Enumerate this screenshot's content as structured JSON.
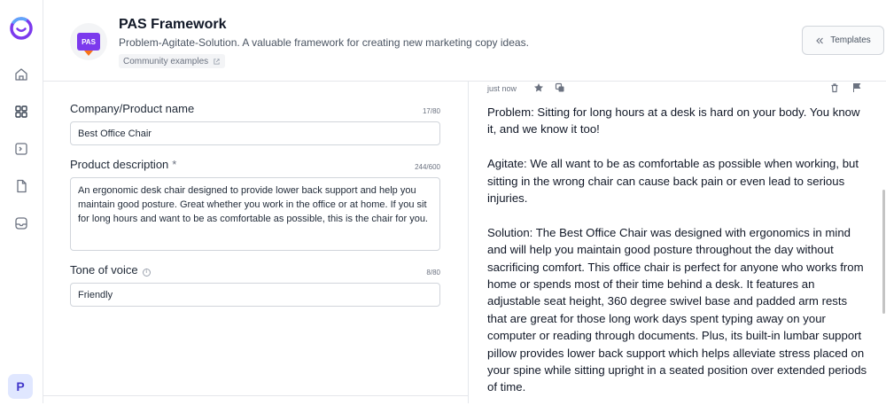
{
  "header": {
    "icon_label": "PAS",
    "title": "PAS Framework",
    "subtitle": "Problem-Agitate-Solution. A valuable framework for creating new marketing copy ideas.",
    "community_link": "Community examples",
    "templates_button": "Templates"
  },
  "sidebar": {
    "items": [
      {
        "icon": "home-icon"
      },
      {
        "icon": "grid-icon"
      },
      {
        "icon": "terminal-icon"
      },
      {
        "icon": "document-icon"
      },
      {
        "icon": "inbox-icon"
      }
    ],
    "avatar_initial": "P"
  },
  "form": {
    "company": {
      "label": "Company/Product name",
      "count": "17/80",
      "value": "Best Office Chair"
    },
    "description": {
      "label": "Product description",
      "required_marker": "*",
      "count": "244/600",
      "value": "An ergonomic desk chair designed to provide lower back support and help you maintain good posture. Great whether you work in the office or at home. If you sit for long hours and want to be as comfortable as possible, this is the chair for you."
    },
    "tone": {
      "label": "Tone of voice",
      "count": "8/80",
      "value": "Friendly"
    }
  },
  "output": {
    "timestamp": "just now",
    "paragraphs": [
      "Problem: Sitting for long hours at a desk is hard on your body. You know it, and we know it too!",
      "Agitate: We all want to be as comfortable as possible when working, but sitting in the wrong chair can cause back pain or even lead to serious injuries.",
      "Solution: The Best Office Chair was designed with ergonomics in mind and will help you maintain good posture throughout the day without sacrificing comfort. This office chair is perfect for anyone who works from home or spends most of their time behind a desk. It features an adjustable seat height, 360 degree swivel base and padded arm rests that are great for those long work days spent typing away on your computer or reading through documents. Plus, its built-in lumbar support pillow provides lower back support which helps alleviate stress placed on your spine while sitting upright in a seated position over extended periods of time."
    ]
  },
  "colors": {
    "accent": "#7c3aed",
    "badge_orange": "#f97316",
    "avatar_bg": "#e0e7ff"
  }
}
